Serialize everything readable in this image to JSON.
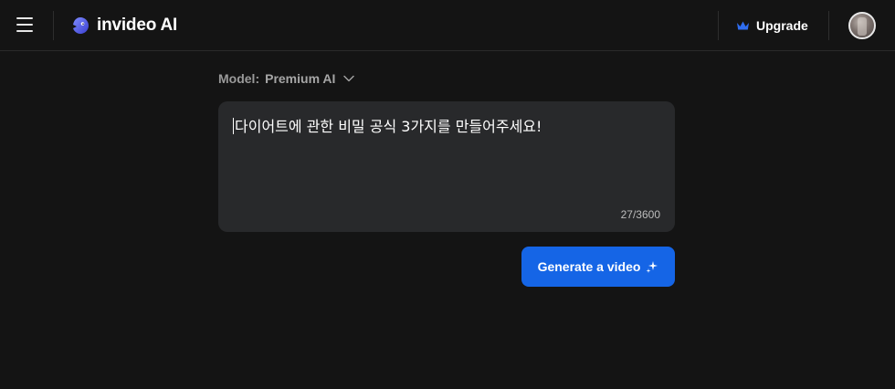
{
  "header": {
    "brand_name": "invideo AI",
    "upgrade_label": "Upgrade",
    "icons": {
      "menu": "hamburger-menu-icon",
      "logo": "invideo-logo-icon",
      "crown": "crown-icon",
      "avatar": "user-avatar"
    }
  },
  "model_selector": {
    "label": "Model:",
    "value": "Premium AI",
    "icon": "chevron-down-icon"
  },
  "prompt": {
    "value": "다이어트에 관한 비밀 공식 3가지를 만들어주세요!",
    "counter": "27/3600"
  },
  "generate_button": {
    "label": "Generate a video",
    "icon": "sparkles-icon"
  },
  "colors": {
    "background": "#141414",
    "prompt_box": "#28292b",
    "accent": "#1565e6",
    "crown": "#2f6df0"
  }
}
